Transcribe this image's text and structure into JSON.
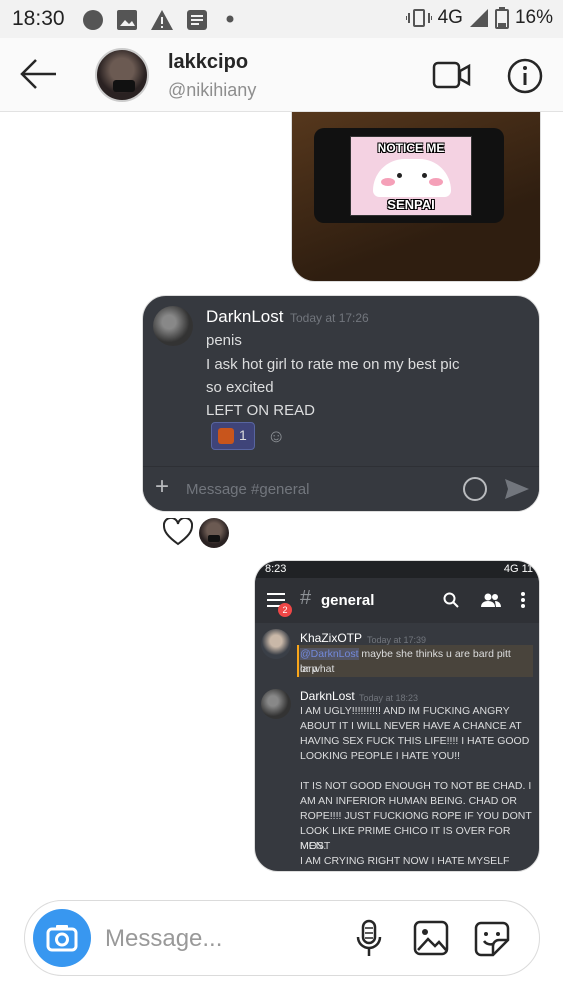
{
  "status_bar": {
    "time": "18:30",
    "network": "4G",
    "battery": "16%"
  },
  "header": {
    "username": "lakkcipo",
    "handle": "@nikihiany"
  },
  "photo1": {
    "top_text": "NOTICE ME",
    "bottom_text": "SENPAI"
  },
  "discord1": {
    "author": "DarknLost",
    "time": "Today at 17:26",
    "lines": [
      "penis",
      "I ask hot girl to rate me on my best pic",
      "so excited",
      "LEFT ON READ"
    ],
    "reaction_count": "1",
    "input_placeholder": "Message #general"
  },
  "discord2": {
    "status_time": "8:23",
    "status_right": "4G  11",
    "badge": "2",
    "channel": "general",
    "msg1": {
      "author": "KhaZixOTP",
      "time": "Today at 17:39",
      "mention": "@DarknLost",
      "text": " maybe she thinks u are bard pitt larp",
      "text2": "or what"
    },
    "msg2": {
      "author": "DarknLost",
      "time": "Today at 18:23",
      "lines": [
        "I AM UGLY!!!!!!!!!! AND IM FUCKING ANGRY",
        "ABOUT IT I WILL NEVER HAVE A CHANCE AT",
        "HAVING SEX FUCK THIS LIFE!!!! I HATE GOOD",
        "LOOKING PEOPLE I HATE YOU!!",
        "",
        "IT IS NOT GOOD ENOUGH TO NOT BE CHAD. I",
        "AM AN INFERIOR HUMAN BEING. CHAD OR",
        "ROPE!!!! JUST FUCKIONG ROPE IF YOU DONT",
        "LOOK LIKE PRIME CHICO IT IS OVER FOR MOST",
        "MEN.",
        "I AM CRYING RIGHT NOW I HATE MYSELF"
      ]
    }
  },
  "composer": {
    "placeholder": "Message..."
  },
  "colors": {
    "accent": "#3897f0",
    "discord_bg": "#36393f",
    "mention": "#7289da"
  },
  "icons": [
    "back-arrow-icon",
    "video-call-icon",
    "info-icon",
    "heart-icon",
    "camera-icon",
    "microphone-icon",
    "gallery-icon",
    "sticker-icon"
  ]
}
